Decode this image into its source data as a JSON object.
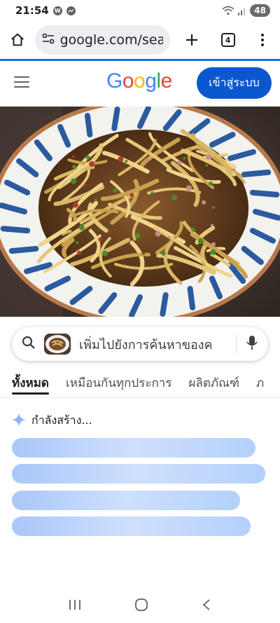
{
  "status": {
    "time": "21:54",
    "app_badge_1": "W",
    "battery": "48"
  },
  "browser": {
    "url": "google.com/sea",
    "tab_count": "4",
    "load_progress": 1.0
  },
  "header": {
    "logo": "Google",
    "signin_label": "เข้าสู่ระบบ"
  },
  "search": {
    "placeholder": "เพิ่มไปยังการค้นหาของคุณ",
    "text": "เพิ่มไปยังการค้นหาของค"
  },
  "tabs": [
    {
      "label": "ทั้งหมด",
      "active": true
    },
    {
      "label": "เหมือนกันทุกประการ",
      "active": false
    },
    {
      "label": "ผลิตภัณฑ์",
      "active": false
    },
    {
      "label": "ภ",
      "active": false
    }
  ],
  "generating": {
    "label": "กำลังสร้าง..."
  },
  "colors": {
    "accent": "#0b57d0",
    "skeleton": "#a9c7fa"
  },
  "icons": [
    "home-icon",
    "site-settings-icon",
    "plus-icon",
    "tabs-icon",
    "more-vert-icon",
    "menu-icon",
    "search-icon",
    "mic-icon",
    "sparkle-icon",
    "recents-icon",
    "home-nav-icon",
    "back-icon"
  ]
}
